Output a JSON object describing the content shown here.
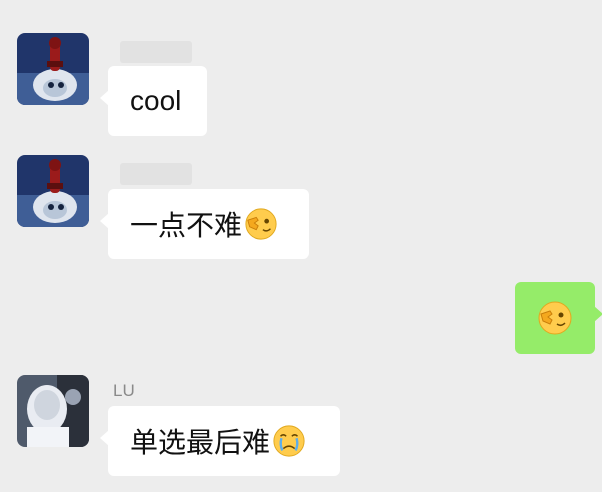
{
  "chat": {
    "messages": [
      {
        "side": "left",
        "sender": "",
        "text": "cool",
        "emoji": ""
      },
      {
        "side": "left",
        "sender": "",
        "text": "一点不难",
        "emoji": "wink-hand-emoji"
      },
      {
        "side": "right",
        "sender": "",
        "text": "",
        "emoji": "wink-hand-emoji"
      },
      {
        "side": "left",
        "sender": "LU",
        "text": "单选最后难",
        "emoji": "crying-emoji"
      }
    ]
  }
}
